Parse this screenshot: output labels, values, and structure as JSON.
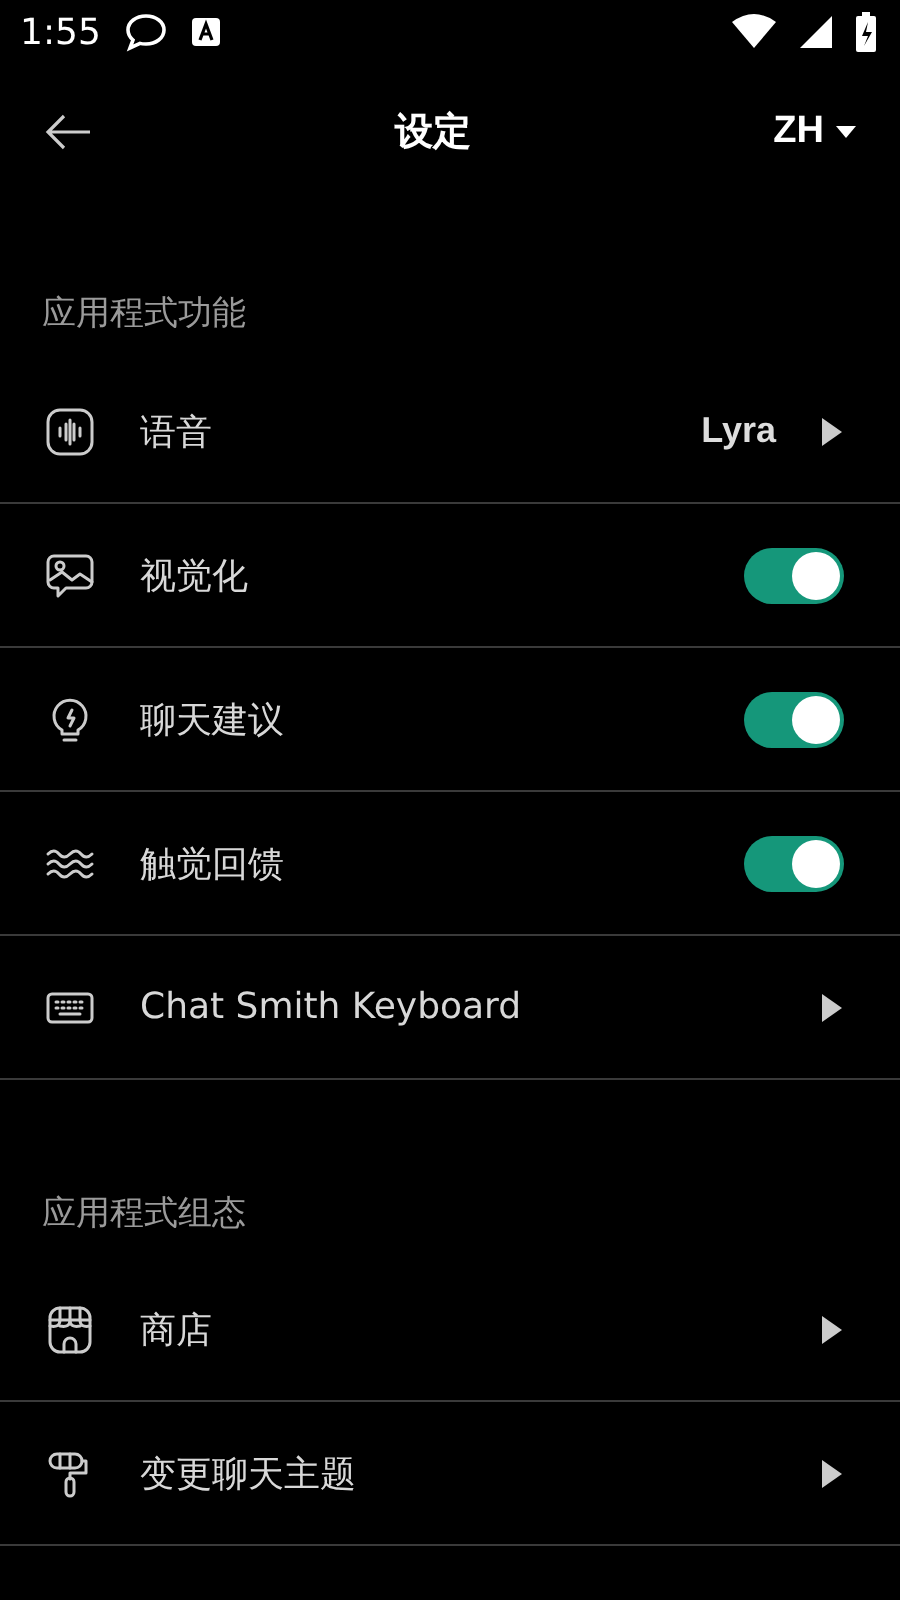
{
  "status_bar": {
    "time": "1:55"
  },
  "header": {
    "title": "设定",
    "language": "ZH"
  },
  "sections": [
    {
      "title": "应用程式功能",
      "items": [
        {
          "kind": "value",
          "label": "语音",
          "value": "Lyra"
        },
        {
          "kind": "toggle",
          "label": "视觉化",
          "on": true
        },
        {
          "kind": "toggle",
          "label": "聊天建议",
          "on": true
        },
        {
          "kind": "toggle",
          "label": "触觉回馈",
          "on": true
        },
        {
          "kind": "link",
          "label": "Chat Smith Keyboard"
        }
      ]
    },
    {
      "title": "应用程式组态",
      "items": [
        {
          "kind": "link",
          "label": "商店"
        },
        {
          "kind": "link",
          "label": "变更聊天主题"
        }
      ]
    }
  ]
}
